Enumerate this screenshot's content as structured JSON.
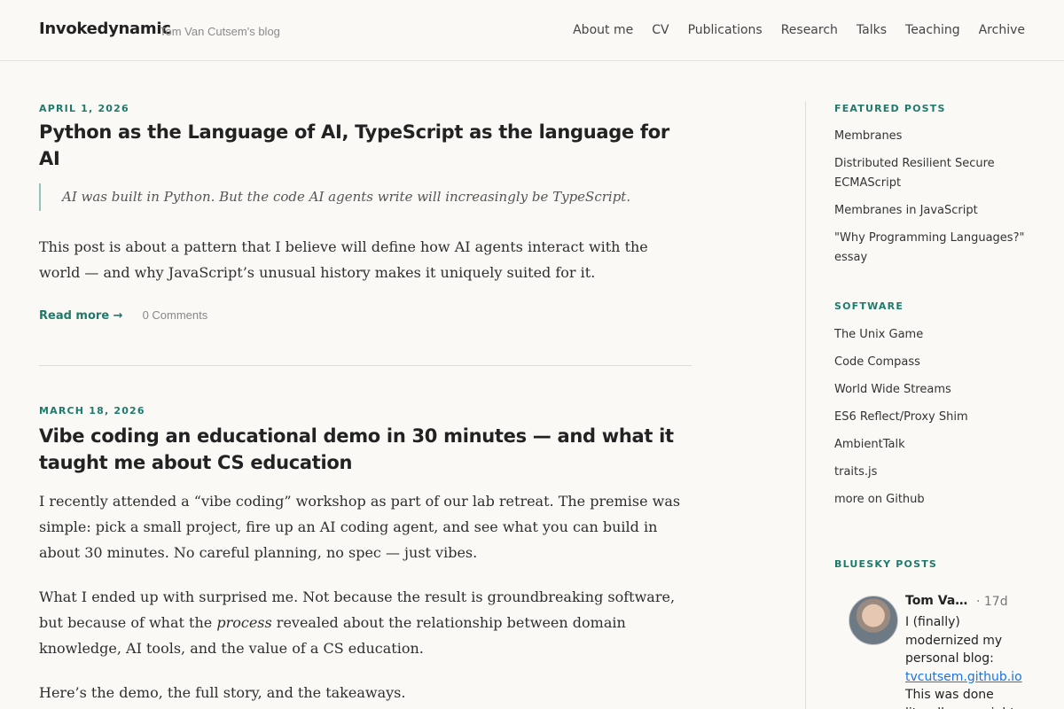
{
  "header": {
    "site_title": "Invokedynamic",
    "tagline": "Tom Van Cutsem's blog",
    "nav": [
      "About me",
      "CV",
      "Publications",
      "Research",
      "Talks",
      "Teaching",
      "Archive"
    ]
  },
  "posts": [
    {
      "date": "April 1, 2026",
      "title": "Python as the Language of AI, TypeScript as the language for AI",
      "quote": "AI was built in Python. But the code AI agents write will increasingly be TypeScript.",
      "excerpt": "This post is about a pattern that I believe will define how AI agents interact with the world — and why JavaScript’s unusual history makes it uniquely suited for it.",
      "read_more": "Read more →",
      "comments": "0 Comments"
    },
    {
      "date": "March 18, 2026",
      "title": "Vibe coding an educational demo in 30 minutes — and what it taught me about CS education",
      "p1": "I recently attended a “vibe coding” workshop as part of our lab retreat. The premise was simple: pick a small project, fire up an AI coding agent, and see what you can build in about 30 minutes. No careful planning, no spec — just vibes.",
      "p2_before": "What I ended up with surprised me. Not because the result is groundbreaking software, but because of what the ",
      "p2_em": "process",
      "p2_after": " revealed about the relationship between domain knowledge, AI tools, and the value of a CS education.",
      "p3": "Here’s the demo, the full story, and the takeaways."
    }
  ],
  "sidebar": {
    "featured_heading": "Featured Posts",
    "featured": [
      "Membranes",
      "Distributed Resilient Secure ECMAScript",
      "Membranes in JavaScript",
      "\"Why Programming Languages?\" essay"
    ],
    "software_heading": "Software",
    "software": [
      "The Unix Game",
      "Code Compass",
      "World Wide Streams",
      "ES6 Reflect/Proxy Shim",
      "AmbientTalk",
      "traits.js",
      "more on Github"
    ],
    "bluesky_heading": "Bluesky Posts",
    "bluesky": {
      "author": "Tom Van Cutsem",
      "age": "· 17d",
      "text_before": "I (finally) modernized my personal blog: ",
      "link": "tvcutsem.github.io",
      "text_after": " This was done literally overnight"
    }
  },
  "colors": {
    "accent": "#1f7a6c",
    "background": "#faf9f6",
    "link": "#1b74e4"
  }
}
